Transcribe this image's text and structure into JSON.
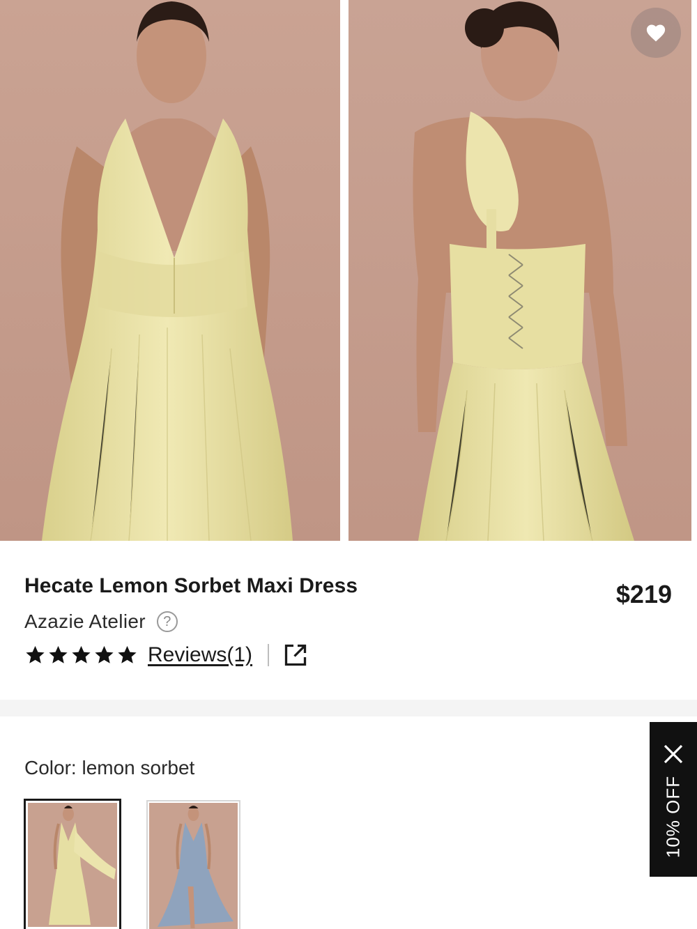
{
  "gallery": {
    "images": [
      {
        "icon": "dress-front-photo"
      },
      {
        "icon": "dress-back-photo"
      }
    ],
    "favorite_icon": "heart-icon"
  },
  "product": {
    "title": "Hecate Lemon Sorbet Maxi Dress",
    "price": "$219",
    "brand": "Azazie Atelier",
    "help_icon_glyph": "?",
    "rating": {
      "stars": 5,
      "out_of": 5
    },
    "reviews_label": "Reviews(1)",
    "share_icon": "external-link-icon"
  },
  "color": {
    "label": "Color: lemon sorbet",
    "swatches": [
      {
        "name": "lemon sorbet",
        "selected": true,
        "hex": "#e6dfa3"
      },
      {
        "name": "dusty blue",
        "selected": false,
        "hex": "#8fa3bd"
      }
    ]
  },
  "discount": {
    "label": "10% OFF",
    "close_icon": "close-icon"
  },
  "colors": {
    "backdrop": "#c9a090",
    "dress": "#e9e2a8",
    "text": "#1a1a1a",
    "tab": "#111111"
  }
}
